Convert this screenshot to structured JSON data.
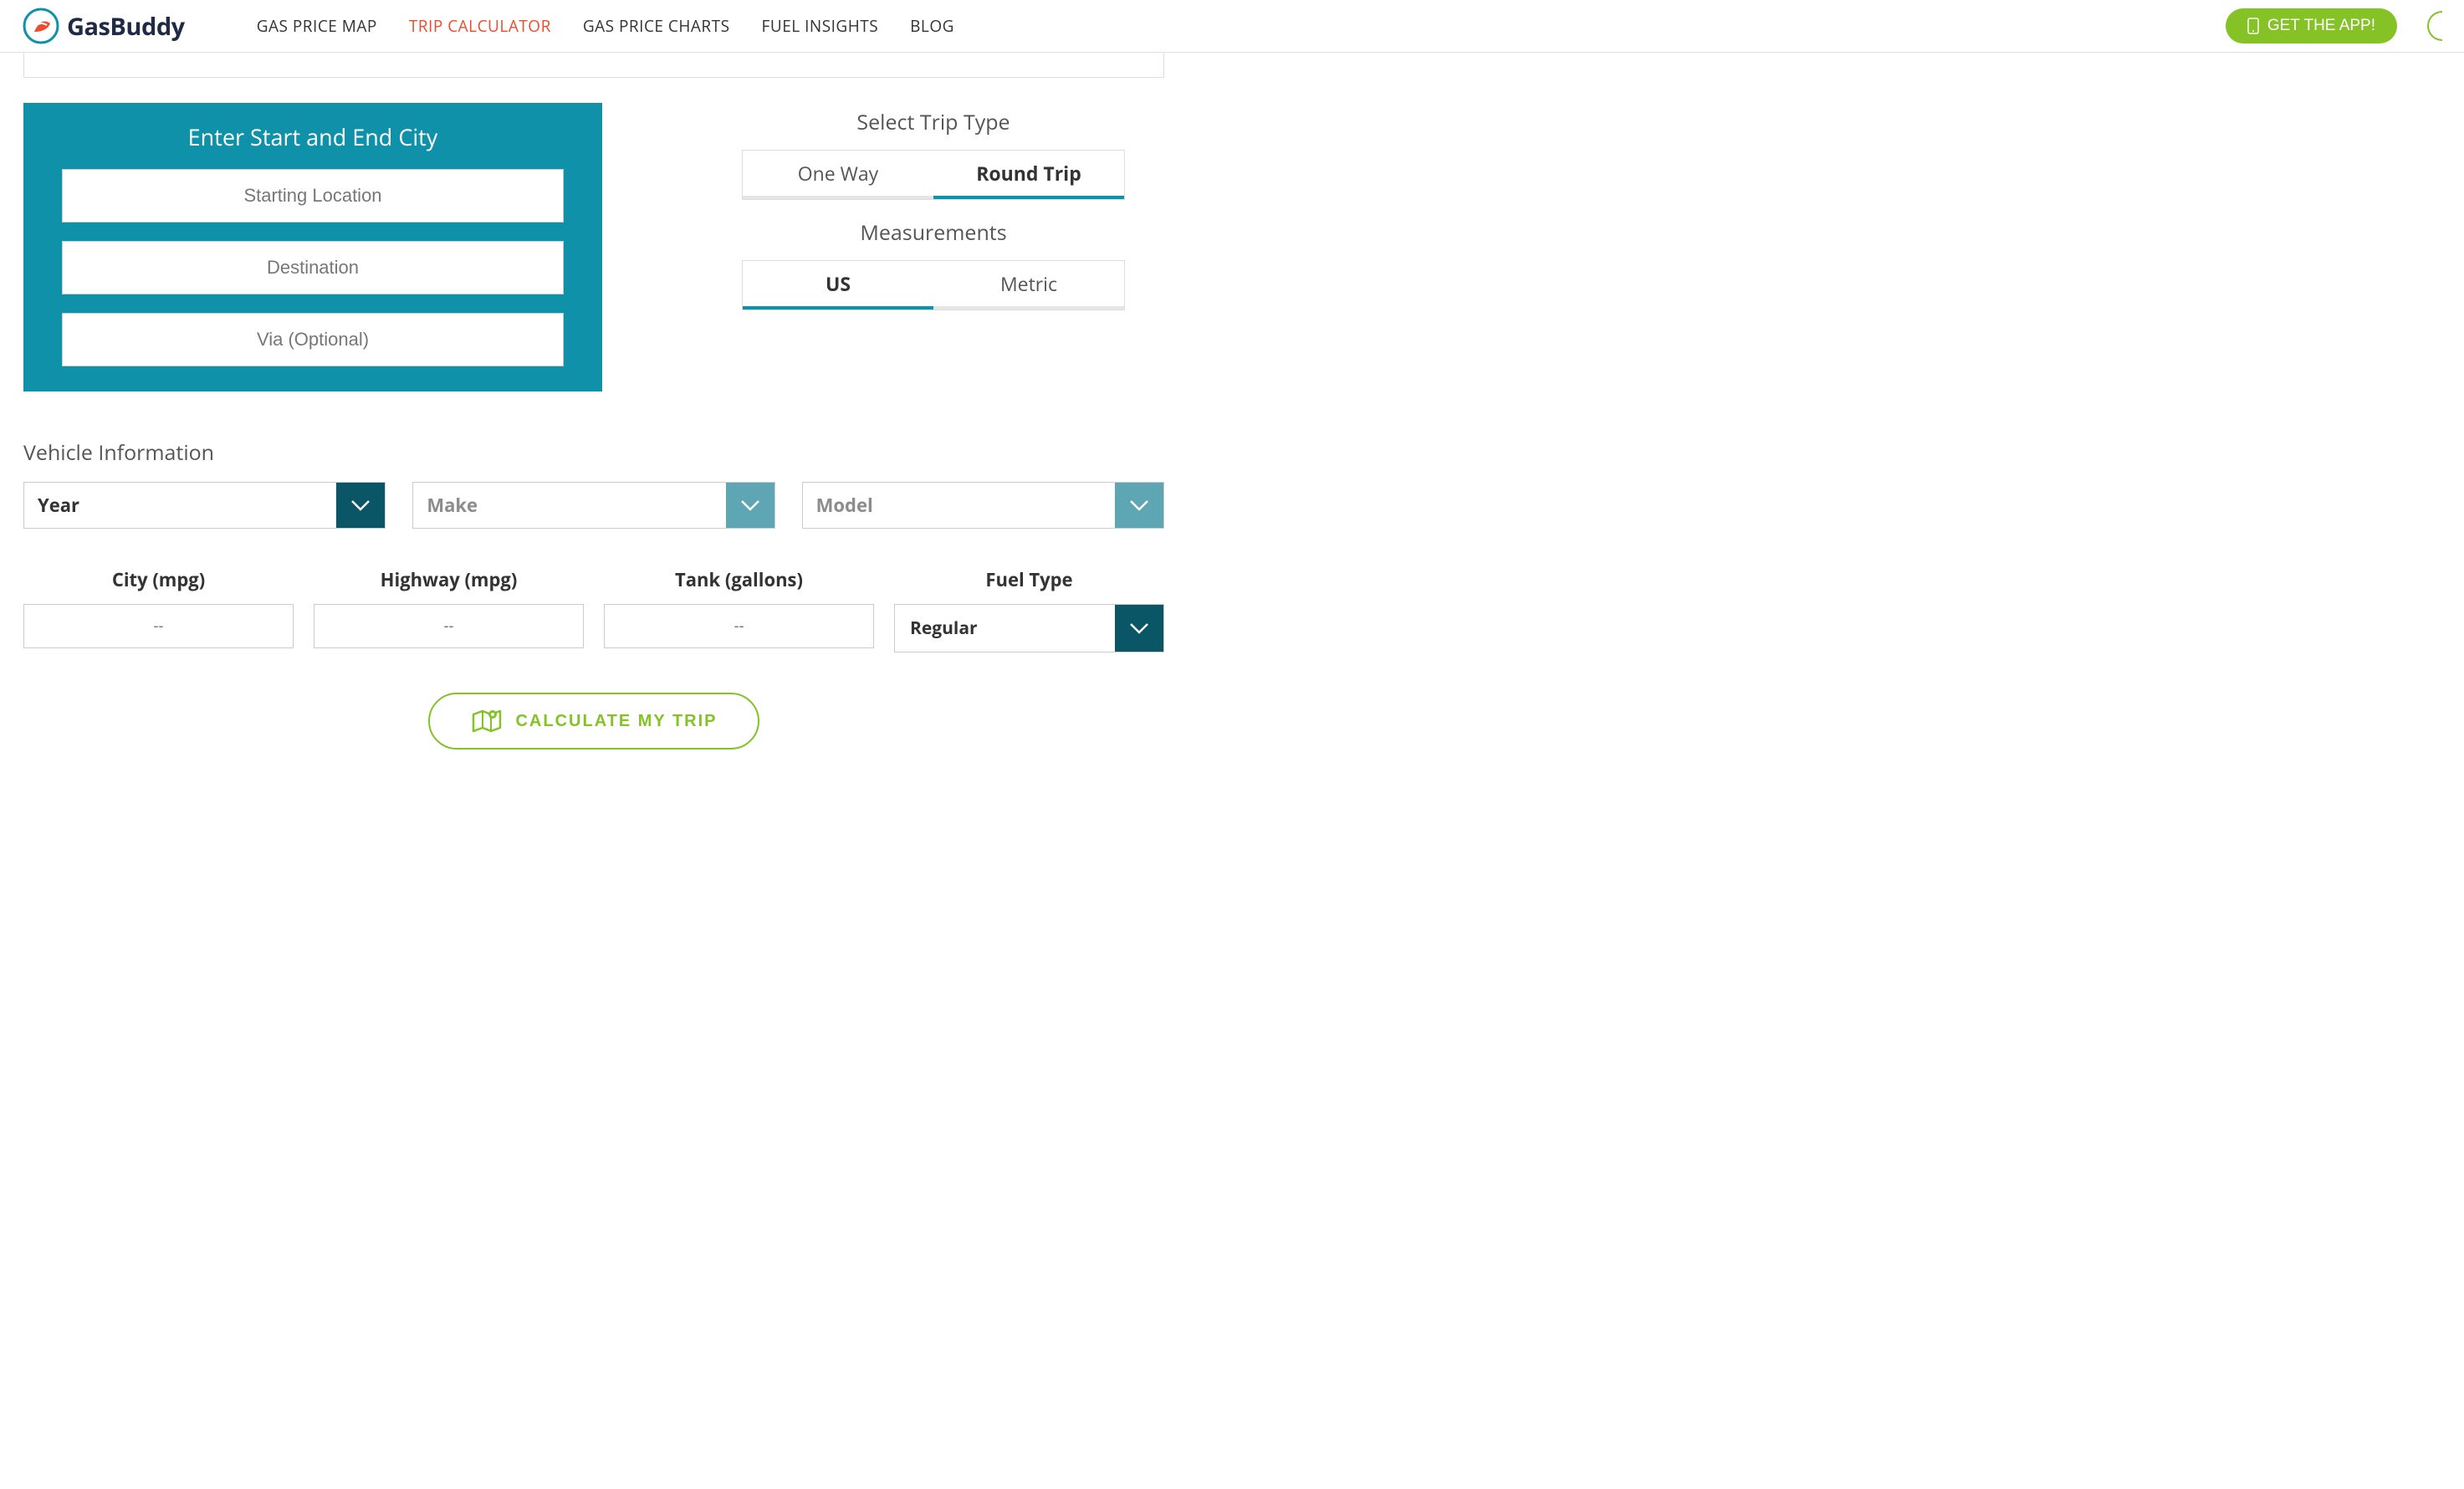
{
  "brand": "GasBuddy",
  "nav": {
    "gas_price_map": "GAS PRICE MAP",
    "trip_calculator": "TRIP CALCULATOR",
    "gas_price_charts": "GAS PRICE CHARTS",
    "fuel_insights": "FUEL INSIGHTS",
    "blog": "BLOG"
  },
  "app_button": "GET THE APP!",
  "locations": {
    "title": "Enter Start and End City",
    "start_placeholder": "Starting Location",
    "dest_placeholder": "Destination",
    "via_placeholder": "Via (Optional)"
  },
  "trip_type": {
    "title": "Select Trip Type",
    "one_way": "One Way",
    "round_trip": "Round Trip"
  },
  "measurements": {
    "title": "Measurements",
    "us": "US",
    "metric": "Metric"
  },
  "vehicle": {
    "title": "Vehicle Information",
    "year": "Year",
    "make": "Make",
    "model": "Model",
    "city_mpg": "City (mpg)",
    "highway_mpg": "Highway (mpg)",
    "tank": "Tank (gallons)",
    "fuel_type_label": "Fuel Type",
    "fuel_type_value": "Regular",
    "placeholder_dash": "--"
  },
  "calculate_label": "CALCULATE MY TRIP"
}
